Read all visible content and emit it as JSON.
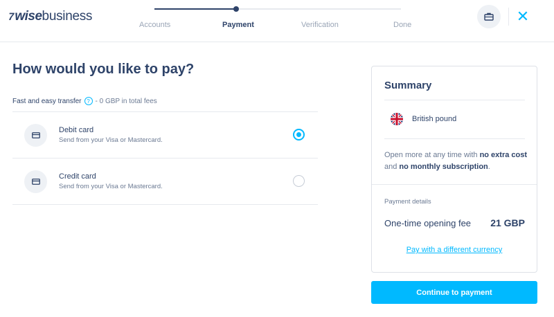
{
  "header": {
    "logo": {
      "flag_glyph": "7",
      "brand_bold": "wise",
      "brand_regular": "business"
    },
    "steps": [
      {
        "label": "Accounts",
        "state": "done"
      },
      {
        "label": "Payment",
        "state": "active"
      },
      {
        "label": "Verification",
        "state": "upcoming"
      },
      {
        "label": "Done",
        "state": "upcoming"
      }
    ],
    "briefcase_icon": "briefcase-icon",
    "close_glyph": "✕"
  },
  "main": {
    "title": "How would you like to pay?",
    "fee_line": {
      "label": "Fast and easy transfer",
      "help_glyph": "?",
      "text": "- 0 GBP in total fees"
    },
    "options": [
      {
        "title": "Debit card",
        "subtitle": "Send from your Visa or Mastercard.",
        "icon": "card-icon",
        "selected": true
      },
      {
        "title": "Credit card",
        "subtitle": "Send from your Visa or Mastercard.",
        "icon": "card-icon",
        "selected": false
      }
    ]
  },
  "summary": {
    "title": "Summary",
    "currency": {
      "name": "British pound",
      "flag": "uk-flag-icon"
    },
    "note": {
      "part1": "Open more at any time with ",
      "bold1": "no extra cost",
      "part2": " and ",
      "bold2": "no monthly subscription",
      "part3": "."
    },
    "payment_details_label": "Payment details",
    "fee_label": "One-time opening fee",
    "fee_amount": "21 GBP",
    "currency_link": "Pay with a different currency"
  },
  "continue_button": "Continue to payment",
  "colors": {
    "accent": "#00b9ff",
    "navy": "#2e4369",
    "muted": "#6b7a93",
    "border": "#e6e9ee"
  }
}
